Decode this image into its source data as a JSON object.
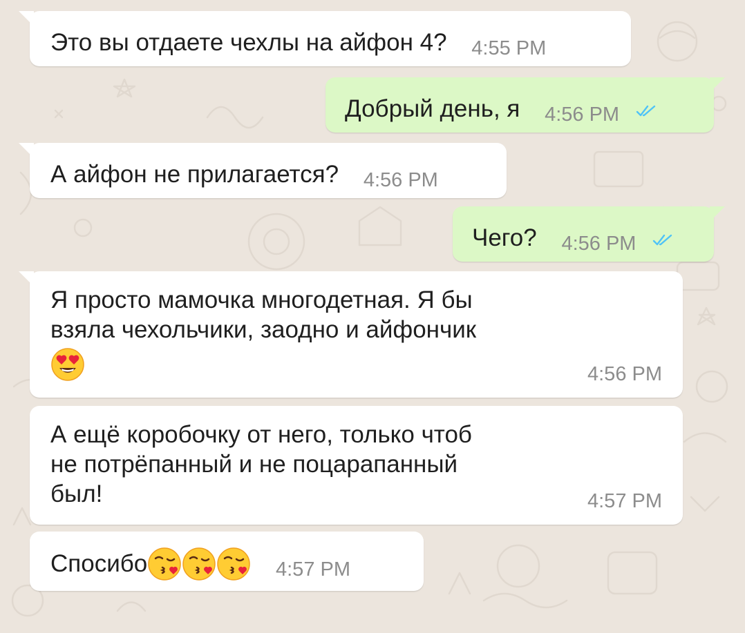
{
  "colors": {
    "chat_background": "#ece5dd",
    "incoming_bubble": "#ffffff",
    "outgoing_bubble": "#dcf8c6",
    "timestamp": "#8c8c8c",
    "read_ticks": "#4fc3f7"
  },
  "messages": [
    {
      "direction": "incoming",
      "text": "Это вы отдаете чехлы на айфон 4?",
      "time": "4:55 PM"
    },
    {
      "direction": "outgoing",
      "text": "Добрый день, я",
      "time": "4:56 PM",
      "status_icon": "double-check-read-icon"
    },
    {
      "direction": "incoming",
      "text": "А айфон не прилагается?",
      "time": "4:56 PM"
    },
    {
      "direction": "outgoing",
      "text": "Чего?",
      "time": "4:56 PM",
      "status_icon": "double-check-read-icon"
    },
    {
      "direction": "incoming",
      "lines": [
        "Я просто мамочка многодетная. Я бы",
        "взяла чехольчики, заодно и айфончик"
      ],
      "emoji": "heart-eyes-emoji",
      "time": "4:56 PM"
    },
    {
      "direction": "incoming",
      "lines": [
        "А ещё коробочку от него, только чтоб",
        "не потрёпанный и не поцарапанный",
        "был!"
      ],
      "time": "4:57 PM"
    },
    {
      "direction": "incoming",
      "text": "Спосибо",
      "emojis": [
        "kissing-heart-emoji",
        "kissing-heart-emoji",
        "kissing-heart-emoji"
      ],
      "time": "4:57 PM"
    }
  ]
}
